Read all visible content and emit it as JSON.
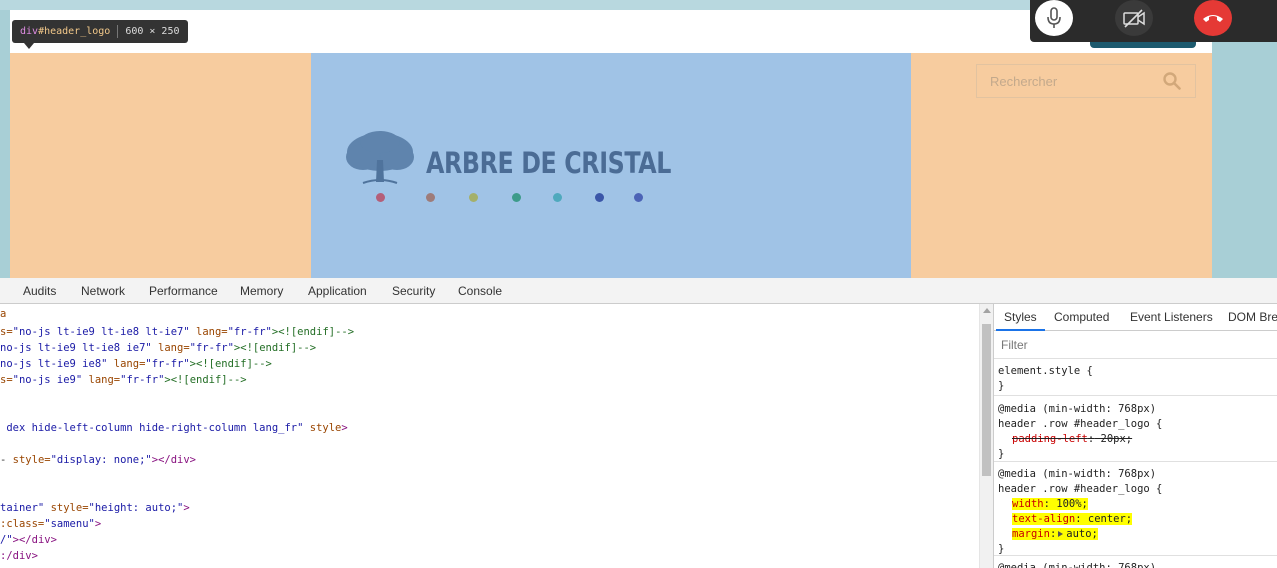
{
  "page": {
    "search_placeholder": "Rechercher",
    "logo_text": "ARBRE DE CRISTAL",
    "logo_dots": [
      "#b45f79",
      "#9e7c7a",
      "#a4b06a",
      "#3d9b8a",
      "#4fa9bd",
      "#3b56a8",
      "#4c63b6"
    ],
    "colors": {
      "header_side": "#f7cc9f",
      "header_logo": "#a0c3e6",
      "logo_text": "#4b6c95"
    }
  },
  "tooltip": {
    "tag": "div",
    "id": "#header_logo",
    "size": "600 × 250"
  },
  "call_controls": {
    "mic": "microphone-icon",
    "camera": "camera-off-icon",
    "hangup": "hang-up-icon"
  },
  "devtools": {
    "tabs": [
      "Audits",
      "Network",
      "Performance",
      "Memory",
      "Application",
      "Security",
      "Console"
    ],
    "dom_lines": [
      {
        "segments": [
          {
            "t": "a",
            "c": "c-attr"
          }
        ]
      },
      {
        "segments": [
          {
            "t": "s=",
            "c": "c-attr"
          },
          {
            "t": "\"no-js lt-ie9 lt-ie8 lt-ie7\"",
            "c": "c-val"
          },
          {
            "t": " lang=",
            "c": "c-attr"
          },
          {
            "t": "\"fr-fr\"",
            "c": "c-val"
          },
          {
            "t": "><![endif]-->",
            "c": "c-cmt"
          }
        ]
      },
      {
        "segments": [
          {
            "t": "no-js lt-ie9 lt-ie8 ie7\"",
            "c": "c-val"
          },
          {
            "t": " lang=",
            "c": "c-attr"
          },
          {
            "t": "\"fr-fr\"",
            "c": "c-val"
          },
          {
            "t": "><![endif]-->",
            "c": "c-cmt"
          }
        ]
      },
      {
        "segments": [
          {
            "t": "no-js lt-ie9 ie8\"",
            "c": "c-val"
          },
          {
            "t": " lang=",
            "c": "c-attr"
          },
          {
            "t": "\"fr-fr\"",
            "c": "c-val"
          },
          {
            "t": "><![endif]-->",
            "c": "c-cmt"
          }
        ]
      },
      {
        "segments": [
          {
            "t": "s=",
            "c": "c-attr"
          },
          {
            "t": "\"no-js ie9\"",
            "c": "c-val"
          },
          {
            "t": " lang=",
            "c": "c-attr"
          },
          {
            "t": "\"fr-fr\"",
            "c": "c-val"
          },
          {
            "t": "><![endif]-->",
            "c": "c-cmt"
          }
        ]
      },
      {
        "segments": []
      },
      {
        "segments": []
      },
      {
        "segments": [
          {
            "t": " dex hide-left-column hide-right-column lang_fr\"",
            "c": "c-val"
          },
          {
            "t": " style",
            "c": "c-attr"
          },
          {
            "t": ">",
            "c": "c-tag"
          }
        ]
      },
      {
        "segments": []
      },
      {
        "segments": [
          {
            "t": "- ",
            "c": "c-plain"
          },
          {
            "t": "style=",
            "c": "c-attr"
          },
          {
            "t": "\"display: none;\"",
            "c": "c-val"
          },
          {
            "t": "></div>",
            "c": "c-tag"
          }
        ]
      },
      {
        "segments": []
      },
      {
        "segments": []
      },
      {
        "segments": [
          {
            "t": "tainer\"",
            "c": "c-val"
          },
          {
            "t": " style=",
            "c": "c-attr"
          },
          {
            "t": "\"height: auto;\"",
            "c": "c-val"
          },
          {
            "t": ">",
            "c": "c-tag"
          }
        ]
      },
      {
        "segments": [
          {
            "t": ":class=",
            "c": "c-attr"
          },
          {
            "t": "\"samenu\"",
            "c": "c-val"
          },
          {
            "t": ">",
            "c": "c-tag"
          }
        ]
      },
      {
        "segments": [
          {
            "t": "/\"",
            "c": "c-val"
          },
          {
            "t": "></div>",
            "c": "c-tag"
          }
        ]
      },
      {
        "segments": [
          {
            "t": ":/div>",
            "c": "c-tag"
          }
        ]
      }
    ],
    "styles_tabs": [
      "Styles",
      "Computed",
      "Event Listeners",
      "DOM Bre"
    ],
    "filter_placeholder": "Filter",
    "rules": [
      {
        "lines": [
          {
            "text": "element.style {"
          },
          {
            "text": "}"
          }
        ]
      },
      {
        "lines": [
          {
            "text": "@media (min-width: 768px)"
          },
          {
            "text": "header .row #header_logo {"
          },
          {
            "prop": "padding-left",
            "val": "20px;",
            "strike": true
          },
          {
            "text": "}"
          }
        ]
      },
      {
        "lines": [
          {
            "text": "@media (min-width: 768px)"
          },
          {
            "text": "header .row #header_logo {"
          },
          {
            "prop": "width",
            "val": "100%;",
            "highlight": true
          },
          {
            "prop": "text-align",
            "val": "center;",
            "highlight": true
          },
          {
            "prop": "margin",
            "val": "auto;",
            "highlight": true,
            "expand": true
          },
          {
            "text": "}"
          }
        ]
      },
      {
        "lines": [
          {
            "text": "@media (min-width: 768px)"
          }
        ]
      }
    ]
  }
}
